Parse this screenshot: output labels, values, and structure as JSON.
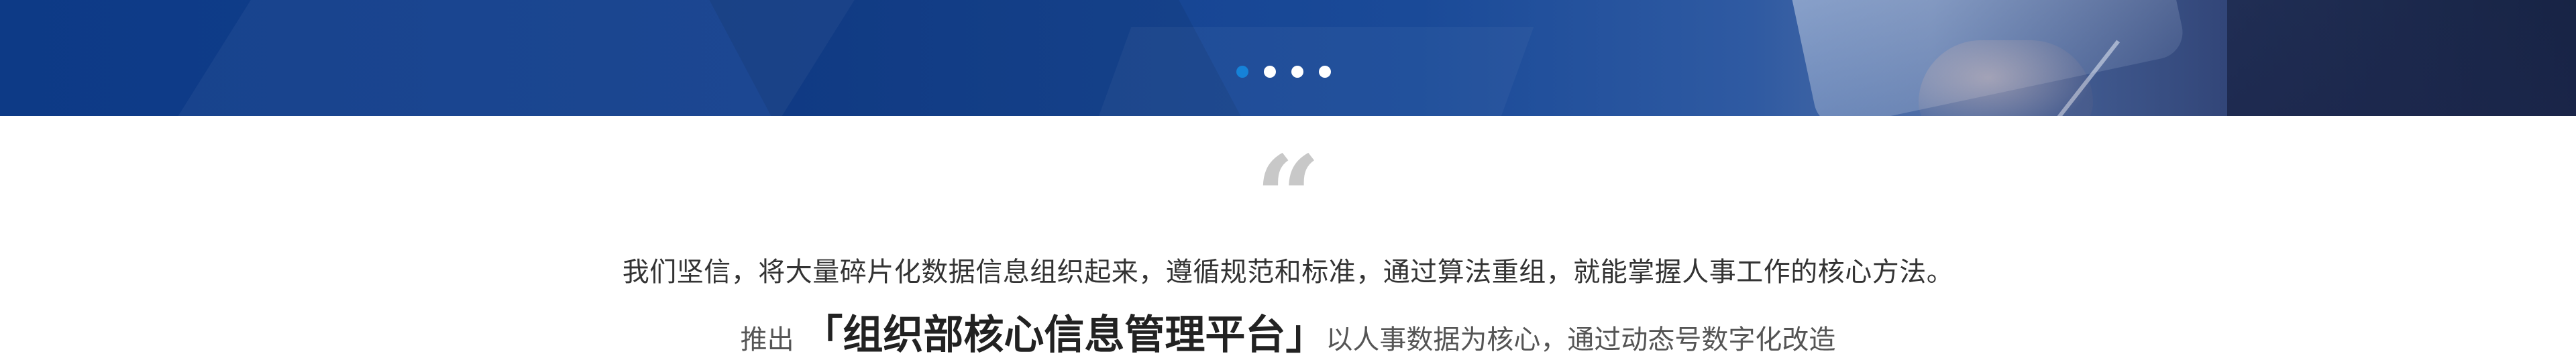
{
  "carousel": {
    "slide_count": 4,
    "active_index": 0,
    "dots": [
      {
        "label": "slide-1"
      },
      {
        "label": "slide-2"
      },
      {
        "label": "slide-3"
      },
      {
        "label": "slide-4"
      }
    ],
    "active_color": "#1682d8",
    "inactive_color": "#ffffff",
    "banner_color": "#123f8e"
  },
  "quote": {
    "mark": "“",
    "statement": "我们坚信，将大量碎片化数据信息组织起来，遵循规范和标准，通过算法重组，就能掌握人事工作的核心方法。",
    "line2_prefix": "推出 ",
    "line2_title": "「组织部核心信息管理平台」",
    "line2_suffix": "以人事数据为核心，通过动态号数字化改造"
  }
}
